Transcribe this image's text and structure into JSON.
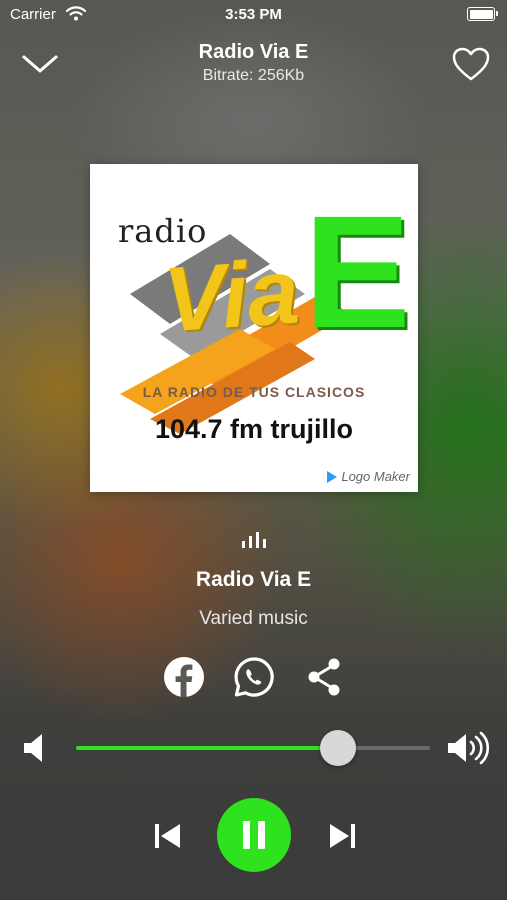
{
  "status_bar": {
    "carrier": "Carrier",
    "time": "3:53 PM",
    "icons": [
      "wifi-icon",
      "battery-icon"
    ]
  },
  "header": {
    "title": "Radio Via E",
    "subtitle": "Bitrate: 256Kb",
    "left_icon": "chevron-down-icon",
    "right_icon": "heart-icon"
  },
  "artwork": {
    "small_word": "radio",
    "big_word": "Via",
    "big_letter": "E",
    "slogan": "LA RADIO DE TUS CLASICOS",
    "frequency": "104.7 fm trujillo",
    "watermark": "Logo Maker"
  },
  "now_playing": {
    "visualizer_icon": "equalizer-icon",
    "station": "Radio Via E",
    "genre": "Varied music"
  },
  "share": [
    "facebook-icon",
    "whatsapp-icon",
    "share-icon"
  ],
  "volume": {
    "level": 0.74,
    "min_icon": "speaker-low-icon",
    "max_icon": "speaker-high-icon"
  },
  "controls": {
    "previous_icon": "skip-previous-icon",
    "pause_icon": "pause-icon",
    "next_icon": "skip-next-icon"
  },
  "colors": {
    "accent": "#2ee31e",
    "track": "#6a6a6a",
    "thumb": "#d8d8d8"
  }
}
